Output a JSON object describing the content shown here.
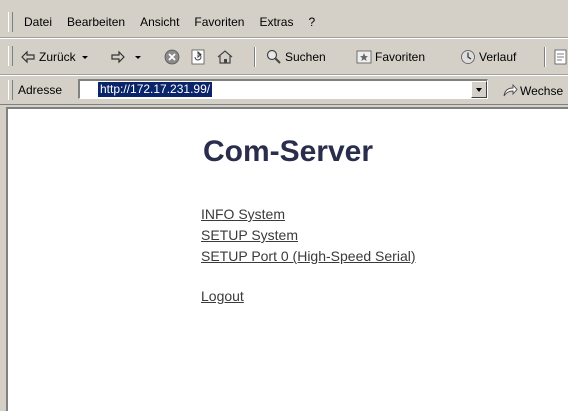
{
  "menu": {
    "items": [
      "Datei",
      "Bearbeiten",
      "Ansicht",
      "Favoriten",
      "Extras",
      "?"
    ]
  },
  "toolbar": {
    "back_label": "Zurück",
    "search_label": "Suchen",
    "favorites_label": "Favoriten",
    "history_label": "Verlauf"
  },
  "address": {
    "label": "Adresse",
    "url": "http://172.17.231.99/",
    "go_label": "Wechse"
  },
  "page": {
    "title": "Com-Server",
    "links": [
      "INFO System",
      "SETUP System",
      "SETUP Port 0 (High-Speed Serial)"
    ],
    "logout": "Logout"
  },
  "colors": {
    "chrome": "#d4d0c8",
    "title": "#2a2e4c",
    "link": "#3a3a3a",
    "url_highlight": "#0a246a"
  }
}
